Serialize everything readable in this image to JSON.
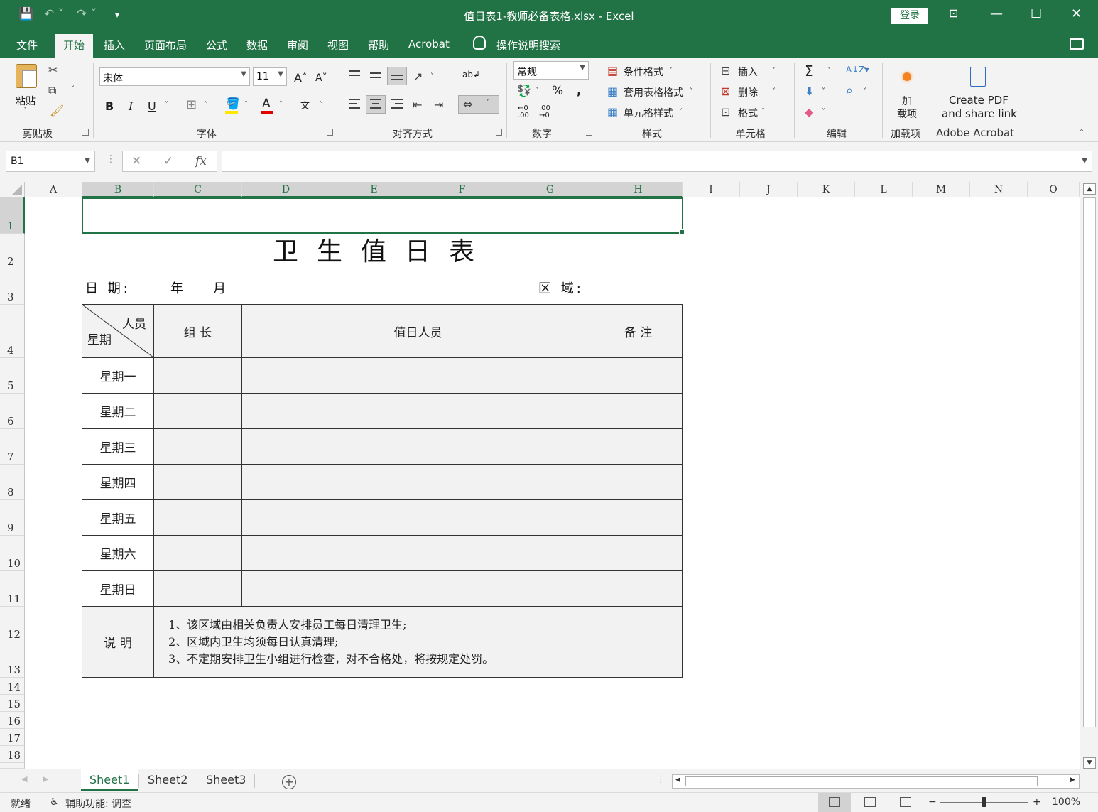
{
  "titlebar": {
    "title": "值日表1-教师必备表格.xlsx  -  Excel",
    "login": "登录"
  },
  "menu": {
    "tabs": [
      "文件",
      "开始",
      "插入",
      "页面布局",
      "公式",
      "数据",
      "审阅",
      "视图",
      "帮助",
      "Acrobat"
    ],
    "active": "开始",
    "tell_me": "操作说明搜索"
  },
  "ribbon": {
    "clipboard": {
      "paste": "粘贴",
      "label": "剪贴板"
    },
    "font": {
      "name": "宋体",
      "size": "11",
      "bold": "B",
      "italic": "I",
      "underline": "U",
      "label": "字体",
      "font_color": "#e00000",
      "fill_color": "#ffe800"
    },
    "alignment": {
      "label": "对齐方式"
    },
    "number": {
      "format": "常规",
      "label": "数字"
    },
    "styles": {
      "conditional": "条件格式",
      "table": "套用表格格式",
      "cell": "单元格样式",
      "label": "样式"
    },
    "cells": {
      "insert": "插入",
      "delete": "删除",
      "format": "格式",
      "label": "单元格"
    },
    "editing": {
      "label": "编辑"
    },
    "addins": {
      "line1": "加",
      "line2": "载项",
      "label": "加载项"
    },
    "acrobat": {
      "line1": "Create PDF",
      "line2": "and share link",
      "label": "Adobe Acrobat"
    }
  },
  "formula_bar": {
    "name_box": "B1",
    "formula": ""
  },
  "grid": {
    "columns": [
      "A",
      "B",
      "C",
      "D",
      "E",
      "F",
      "G",
      "H",
      "I",
      "J",
      "K",
      "L",
      "M",
      "N",
      "O"
    ],
    "rows": [
      "1",
      "2",
      "3",
      "4",
      "5",
      "6",
      "7",
      "8",
      "9",
      "10",
      "11",
      "12",
      "13",
      "14",
      "15",
      "16",
      "17",
      "18"
    ]
  },
  "sheet": {
    "title": "卫生值日表",
    "date_label": "日  期:",
    "year": "年",
    "month": "月",
    "area_label": "区  域:",
    "header": {
      "diag_top": "人员",
      "diag_bottom": "星期",
      "leader": "组 长",
      "members": "值日人员",
      "remark": "备 注"
    },
    "days": [
      "星期一",
      "星期二",
      "星期三",
      "星期四",
      "星期五",
      "星期六",
      "星期日"
    ],
    "note_label": "说  明",
    "notes": [
      "1、该区域由相关负责人安排员工每日清理卫生;",
      "2、区域内卫生均须每日认真清理;",
      "3、不定期安排卫生小组进行检查，对不合格处，将按规定处罚。"
    ]
  },
  "sheet_tabs": [
    "Sheet1",
    "Sheet2",
    "Sheet3"
  ],
  "status": {
    "ready": "就绪",
    "accessibility": "辅助功能: 调查",
    "zoom": "100%"
  },
  "colors": {
    "accent": "#217346"
  }
}
